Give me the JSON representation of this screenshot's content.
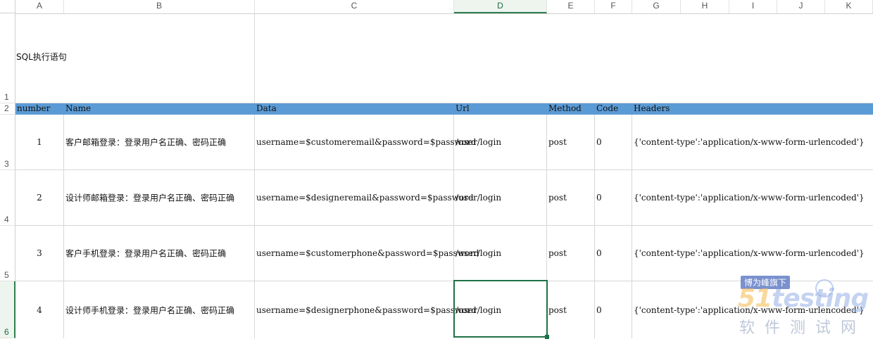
{
  "columns": [
    "A",
    "B",
    "C",
    "D",
    "E",
    "F",
    "G",
    "H",
    "I",
    "J",
    "K"
  ],
  "active_column": "D",
  "rows": [
    "1",
    "2",
    "3",
    "4",
    "5",
    "6"
  ],
  "active_row": "6",
  "title_cell": "SQL执行语句",
  "header": [
    "number",
    "Name",
    "Data",
    "Url",
    "Method",
    "Code",
    "Headers"
  ],
  "data_rows": [
    {
      "number": "1",
      "name": "客户邮箱登录：登录用户名正确、密码正确",
      "data": "username=$customeremail&password=$password",
      "url": "/user/login",
      "method": "post",
      "code": "0",
      "headers": "{'content-type':'application/x-www-form-urlencoded'}"
    },
    {
      "number": "2",
      "name": "设计师邮箱登录：登录用户名正确、密码正确",
      "data": "username=$designeremail&password=$password",
      "url": "/user/login",
      "method": "post",
      "code": "0",
      "headers": "{'content-type':'application/x-www-form-urlencoded'}"
    },
    {
      "number": "3",
      "name": "客户手机登录：登录用户名正确、密码正确",
      "data": "username=$customerphone&password=$password",
      "url": "/user/login",
      "method": "post",
      "code": "0",
      "headers": "{'content-type':'application/x-www-form-urlencoded'}"
    },
    {
      "number": "4",
      "name": "设计师手机登录：登录用户名正确、密码正确",
      "data": "username=$designerphone&password=$password",
      "url": "/user/login",
      "method": "post",
      "code": "0",
      "headers": "{'content-type':'application/x-www-form-urlencoded'}"
    }
  ],
  "watermark": {
    "badge": "博为峰旗下",
    "logo_a": "5",
    "logo_b": "1",
    "logo_c": "testing",
    "subtitle": "软件测试网"
  },
  "colors": {
    "header_fill": "#5b9bd5",
    "selection": "#1e7145"
  }
}
